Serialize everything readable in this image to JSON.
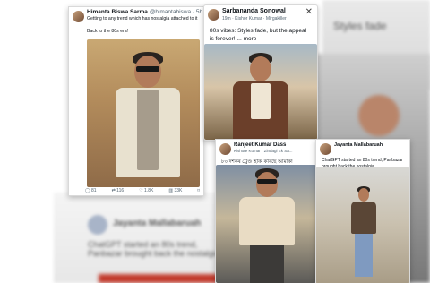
{
  "cards": {
    "himanta": {
      "name": "Himanta Biswa Sarma",
      "handle": "@himantabiswa · 5h",
      "text": "Getting to any trend which has nostalgia attached to it\n\nBack to the 80s era!",
      "stats": {
        "replies": "81",
        "reposts": "116",
        "likes": "1.8K",
        "views": "33K"
      }
    },
    "sarbananda": {
      "name": "Sarbananda Sonowal",
      "sub": "19m · Kishor Kumar · Mirgakiller",
      "text": "80s vibes: Styles fade, but the appeal is forever! ... more"
    },
    "ranjeet": {
      "name": "Ranjeet Kumar Dass",
      "sub": "Kishore Kumar · Zindagi Ek Sa...",
      "text": "৮০ দশকৰ ট্ৰেণ্ড 'হাক' কৰিছে আমাক!"
    },
    "jayanta": {
      "name": "Jayanta Mallabaruah",
      "text": "ChatGPT started an 80s trend, Panbazar brought back the nostalgia."
    }
  },
  "background": {
    "top_right_text": "Styles fade",
    "bottom_text_1": "Jayanta Mallabaruah",
    "bottom_text_2": "ChatGPT started an 80s trend, Panbazar brought back the nostalgia."
  },
  "icons": [
    "close-icon",
    "reply-icon",
    "repost-icon",
    "like-icon",
    "views-icon",
    "bookmark-icon"
  ],
  "colors": {
    "accent": "#c23a2c",
    "text": "#0f1419",
    "muted": "#536471"
  }
}
